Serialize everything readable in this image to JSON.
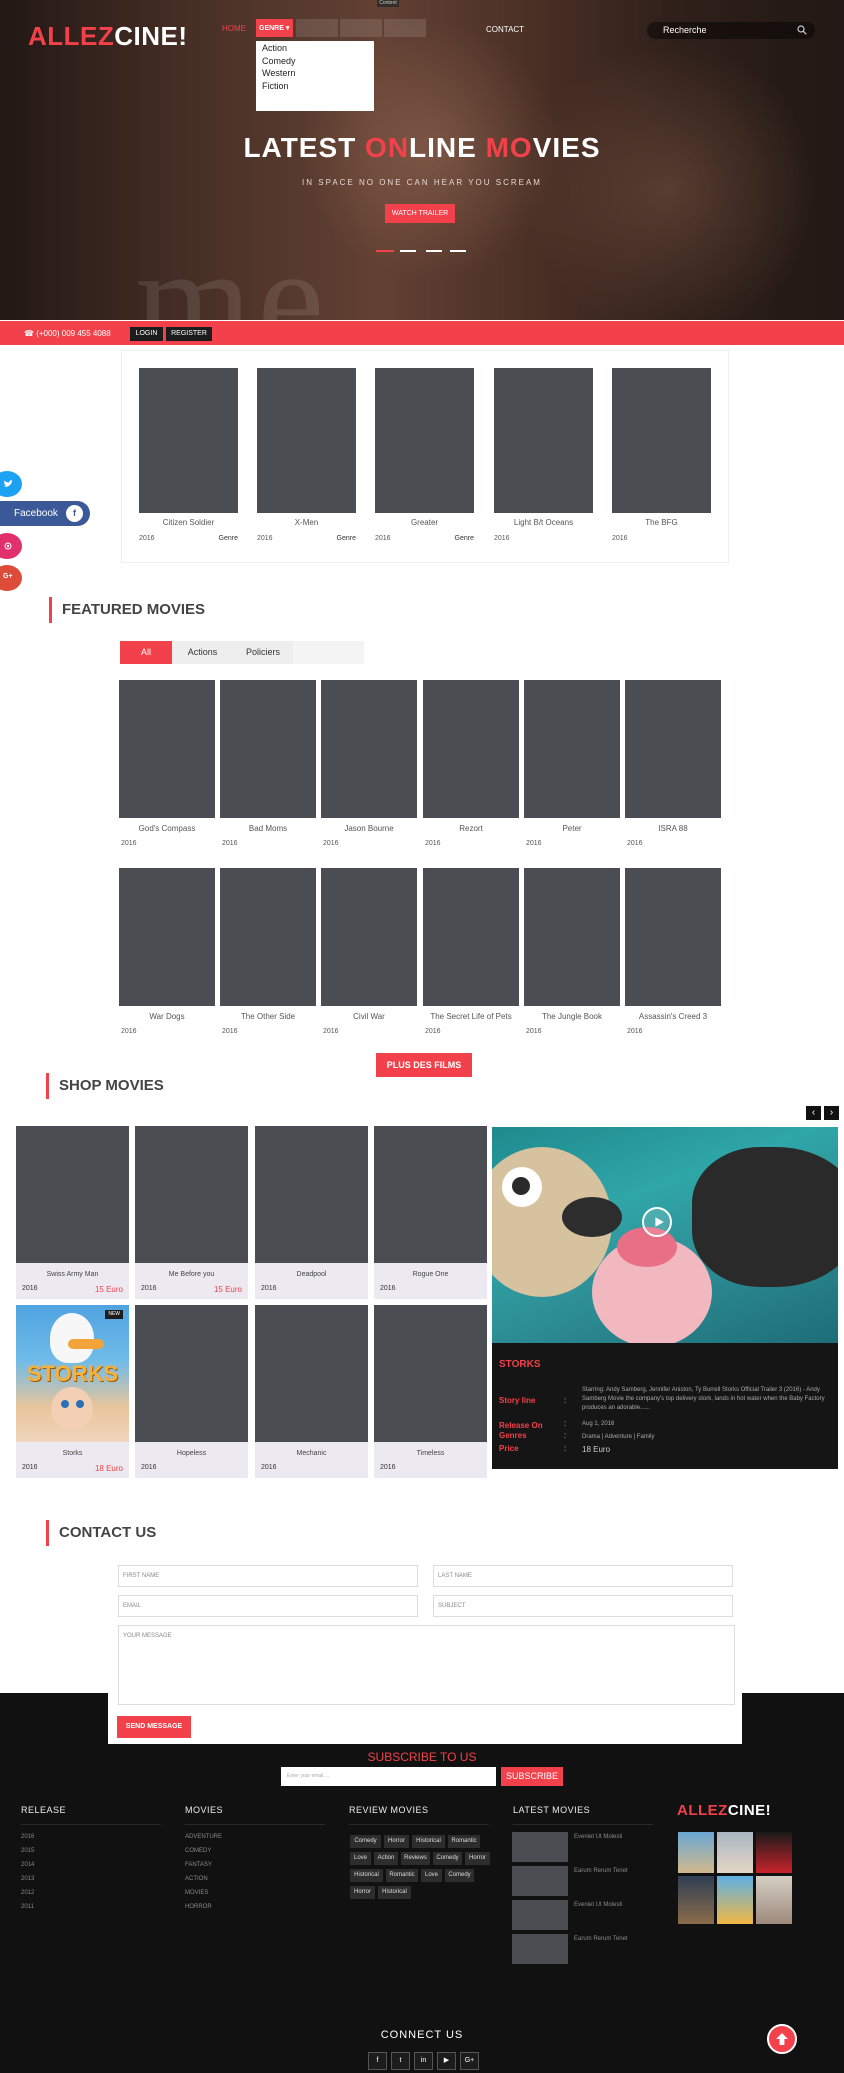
{
  "header": {
    "logo_part1": "ALLEZ",
    "logo_part2": "CINE!",
    "nav": {
      "home": "HOME",
      "genre": "GENRE ▾",
      "contact": "CONTACT",
      "login_tip": "Content"
    },
    "genre_options": [
      "Action",
      "Comedy",
      "Western",
      "Fiction"
    ],
    "search_placeholder": "Recherche"
  },
  "hero": {
    "title_parts": [
      "LATEST ",
      "ON",
      "LINE ",
      "MO",
      "VIES"
    ],
    "subtitle": "IN SPACE NO ONE CAN HEAR YOU SCREAM",
    "button": "WATCH TRAILER",
    "background_word": "me",
    "slides": 4,
    "active_slide": 1
  },
  "contact_bar": {
    "phone": "☎ (+000) 009 455 4088",
    "login": "LOGIN",
    "register": "REGISTER"
  },
  "slider_movies": [
    {
      "title": "Citizen Soldier",
      "year": "2016",
      "genre": "Genre"
    },
    {
      "title": "X-Men",
      "year": "2016",
      "genre": "Genre"
    },
    {
      "title": "Greater",
      "year": "2016",
      "genre": "Genre"
    },
    {
      "title": "Light B/t Oceans",
      "year": "2016",
      "genre": ""
    },
    {
      "title": "The BFG",
      "year": "2016",
      "genre": ""
    }
  ],
  "social": {
    "facebook_label": "Facebook",
    "gplus": "G+",
    "facebook_short": "f"
  },
  "featured": {
    "heading": "FEATURED MOVIES",
    "tabs": [
      "All",
      "Actions",
      "Policiers",
      ""
    ],
    "movies": [
      {
        "title": "God's Compass",
        "year": "2016"
      },
      {
        "title": "Bad Moms",
        "year": "2016"
      },
      {
        "title": "Jason Bourne",
        "year": "2016"
      },
      {
        "title": "Rezort",
        "year": "2016"
      },
      {
        "title": "Peter",
        "year": "2016"
      },
      {
        "title": "ISRA 88",
        "year": "2016"
      },
      {
        "title": "War Dogs",
        "year": "2016"
      },
      {
        "title": "The Other Side",
        "year": "2016"
      },
      {
        "title": "Civil War",
        "year": "2016"
      },
      {
        "title": "The Secret Life of Pets",
        "year": "2016"
      },
      {
        "title": "The Jungle Book",
        "year": "2016"
      },
      {
        "title": "Assassin's Creed 3",
        "year": "2016"
      }
    ],
    "more_button": "PLUS DES FILMS"
  },
  "shop": {
    "heading": "SHOP MOVIES",
    "items": [
      {
        "title": "Swiss Army Man",
        "year": "2016",
        "price": "15 Euro"
      },
      {
        "title": "Me Before you",
        "year": "2016",
        "price": "15 Euro"
      },
      {
        "title": "Deadpool",
        "year": "2016",
        "price": ""
      },
      {
        "title": "Rogue One",
        "year": "2016",
        "price": ""
      },
      {
        "title": "Storks",
        "year": "2016",
        "price": "18 Euro"
      },
      {
        "title": "Hopeless",
        "year": "2016",
        "price": ""
      },
      {
        "title": "Mechanic",
        "year": "2016",
        "price": ""
      },
      {
        "title": "Timeless",
        "year": "2016",
        "price": ""
      }
    ],
    "new_badge": "NEW",
    "poster_word": "STORKS",
    "feature": {
      "title": "STORKS",
      "storyline_label": "Story line",
      "storyline": "Starring: Andy Samberg, Jennifer Aniston, Ty Burrell Storks Official Trailer 3 (2016) - Andy Samberg Movie the company's top delivery stork, lands in hot water when the Baby Factory produces an adorable......",
      "release_label": "Release On",
      "release": "Aug 1, 2016",
      "genres_label": "Genres",
      "genres": "Drama | Adventure | Family",
      "price_label": "Price",
      "price": "18 Euro",
      "colon": ":"
    }
  },
  "contact": {
    "heading": "CONTACT US",
    "first_name": "FIRST NAME",
    "last_name": "LAST NAME",
    "email": "EMAIL",
    "subject": "SUBJECT",
    "message": "YOUR MESSAGE",
    "send": "SEND MESSAGE"
  },
  "subscribe": {
    "title": "SUBSCRIBE TO US",
    "placeholder": "Enter your email....",
    "button": "SUBSCRIBE"
  },
  "footer": {
    "release": {
      "heading": "RELEASE",
      "years": [
        "2016",
        "2015",
        "2014",
        "2013",
        "2012",
        "2011"
      ]
    },
    "movies": {
      "heading": "MOVIES",
      "links": [
        "ADVENTURE",
        "COMEDY",
        "FANTASY",
        "ACTION",
        "MOVIES",
        "HORROR"
      ]
    },
    "review": {
      "heading": "REVIEW MOVIES",
      "tags": [
        [
          "Comedy",
          "Horror",
          "Historical",
          "Romantic"
        ],
        [
          "Love",
          "Action",
          "Reviews",
          "Comedy",
          "Horror"
        ],
        [
          "Historical",
          "Romantic",
          "Love",
          "Comedy"
        ],
        [
          "Horror",
          "Historical"
        ]
      ]
    },
    "latest": {
      "heading": "LATEST MOVIES",
      "titles": [
        "Eveniet Ut Molesti",
        "Earum Rerum Tenet",
        "Eveniet Ut Molesti",
        "Earum Rerum Tenet"
      ]
    },
    "logo_part1": "ALLEZ",
    "logo_part2": "CINE!",
    "connect": "CONNECT US",
    "social_icons": [
      "facebook-icon",
      "twitter-icon",
      "linkedin-icon",
      "youtube-icon",
      "googleplus-icon"
    ],
    "social_glyphs": [
      "f",
      "t",
      "in",
      "▶",
      "G+"
    ]
  },
  "colors": {
    "accent": "#f2414a",
    "dark": "#111111",
    "poster": "#4a4d52"
  }
}
